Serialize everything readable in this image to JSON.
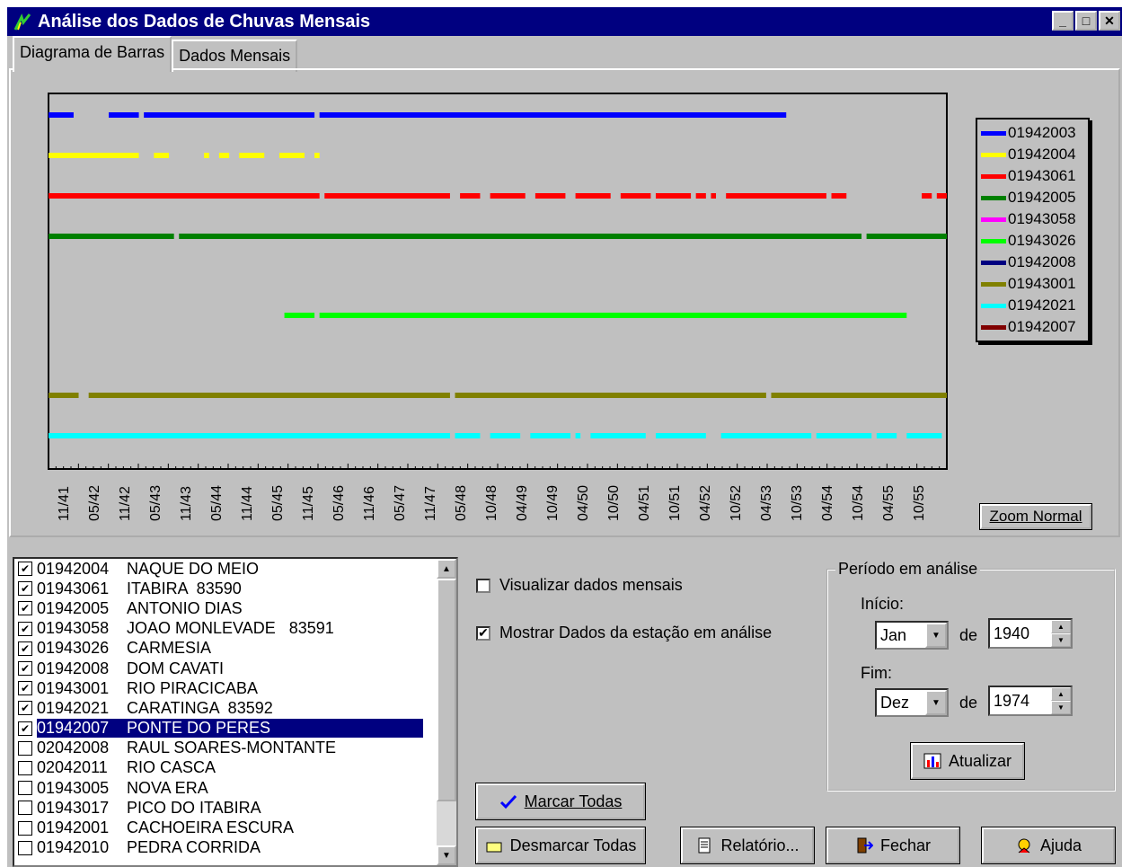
{
  "window": {
    "title": "Análise dos Dados de Chuvas Mensais",
    "min_label": "_",
    "max_label": "□",
    "close_label": "✕"
  },
  "tabs": [
    {
      "label": "Diagrama de Barras",
      "active": true
    },
    {
      "label": "Dados Mensais",
      "active": false
    }
  ],
  "chart": {
    "x_ticks": [
      "11/41",
      "05/42",
      "11/42",
      "05/43",
      "11/43",
      "05/44",
      "11/44",
      "05/45",
      "11/45",
      "05/46",
      "11/46",
      "05/47",
      "11/47",
      "05/48",
      "10/48",
      "04/49",
      "10/49",
      "04/50",
      "10/50",
      "04/51",
      "10/51",
      "04/52",
      "10/52",
      "04/53",
      "10/53",
      "04/54",
      "10/54",
      "04/55",
      "10/55"
    ],
    "zoom_button": "Zoom Normal"
  },
  "chart_data": {
    "type": "bar",
    "title": "",
    "xlabel": "",
    "ylabel": "",
    "x_range": [
      "1941-07",
      "1956-06"
    ],
    "legend_position": "right",
    "series": [
      {
        "name": "01942003",
        "color": "#0000ff",
        "segments": [
          [
            "1941-07",
            "1941-12"
          ],
          [
            "1942-07",
            "1943-01"
          ],
          [
            "1943-02",
            "1945-12"
          ],
          [
            "1946-01",
            "1953-10"
          ]
        ]
      },
      {
        "name": "01942004",
        "color": "#ffff00",
        "segments": [
          [
            "1941-07",
            "1943-01"
          ],
          [
            "1943-04",
            "1943-07"
          ],
          [
            "1944-02",
            "1944-03"
          ],
          [
            "1944-05",
            "1944-07"
          ],
          [
            "1944-09",
            "1945-02"
          ],
          [
            "1945-05",
            "1945-10"
          ],
          [
            "1945-12",
            "1946-01"
          ]
        ]
      },
      {
        "name": "01943061",
        "color": "#ff0000",
        "segments": [
          [
            "1941-07",
            "1946-01"
          ],
          [
            "1946-02",
            "1948-03"
          ],
          [
            "1948-05",
            "1948-09"
          ],
          [
            "1948-11",
            "1949-06"
          ],
          [
            "1949-08",
            "1950-02"
          ],
          [
            "1950-04",
            "1950-11"
          ],
          [
            "1951-01",
            "1951-07"
          ],
          [
            "1951-08",
            "1952-03"
          ],
          [
            "1952-04",
            "1952-06"
          ],
          [
            "1952-07",
            "1952-08"
          ],
          [
            "1952-10",
            "1954-06"
          ],
          [
            "1954-07",
            "1954-10"
          ],
          [
            "1956-01",
            "1956-03"
          ],
          [
            "1956-04",
            "1956-06"
          ]
        ]
      },
      {
        "name": "01942005",
        "color": "#008000",
        "segments": [
          [
            "1941-07",
            "1943-08"
          ],
          [
            "1943-09",
            "1955-01"
          ],
          [
            "1955-02",
            "1956-06"
          ]
        ]
      },
      {
        "name": "01943058",
        "color": "#ff00ff",
        "segments": []
      },
      {
        "name": "01943026",
        "color": "#00ff00",
        "segments": [
          [
            "1945-06",
            "1945-12"
          ],
          [
            "1946-01",
            "1955-10"
          ]
        ]
      },
      {
        "name": "01942008",
        "color": "#000080",
        "segments": []
      },
      {
        "name": "01943001",
        "color": "#808000",
        "segments": [
          [
            "1941-07",
            "1942-01"
          ],
          [
            "1942-03",
            "1948-03"
          ],
          [
            "1948-04",
            "1953-06"
          ],
          [
            "1953-07",
            "1956-06"
          ]
        ]
      },
      {
        "name": "01942021",
        "color": "#00ffff",
        "segments": [
          [
            "1941-07",
            "1948-03"
          ],
          [
            "1948-04",
            "1948-09"
          ],
          [
            "1948-11",
            "1949-05"
          ],
          [
            "1949-07",
            "1950-03"
          ],
          [
            "1950-04",
            "1950-05"
          ],
          [
            "1950-07",
            "1951-06"
          ],
          [
            "1951-08",
            "1952-06"
          ],
          [
            "1952-09",
            "1954-03"
          ],
          [
            "1954-04",
            "1955-03"
          ],
          [
            "1955-04",
            "1955-08"
          ],
          [
            "1955-10",
            "1956-05"
          ]
        ]
      },
      {
        "name": "01942007",
        "color": "#800000",
        "segments": []
      }
    ]
  },
  "stations": [
    {
      "checked": true,
      "code": "01942004",
      "name": "NAQUE DO MEIO",
      "selected": false
    },
    {
      "checked": true,
      "code": "01943061",
      "name": "ITABIRA  83590",
      "selected": false
    },
    {
      "checked": true,
      "code": "01942005",
      "name": "ANTONIO DIAS",
      "selected": false
    },
    {
      "checked": true,
      "code": "01943058",
      "name": "JOAO MONLEVADE   83591",
      "selected": false
    },
    {
      "checked": true,
      "code": "01943026",
      "name": "CARMESIA",
      "selected": false
    },
    {
      "checked": true,
      "code": "01942008",
      "name": "DOM CAVATI",
      "selected": false
    },
    {
      "checked": true,
      "code": "01943001",
      "name": "RIO PIRACICABA",
      "selected": false
    },
    {
      "checked": true,
      "code": "01942021",
      "name": "CARATINGA  83592",
      "selected": false
    },
    {
      "checked": true,
      "code": "01942007",
      "name": "PONTE DO PERES",
      "selected": true
    },
    {
      "checked": false,
      "code": "02042008",
      "name": "RAUL SOARES-MONTANTE",
      "selected": false
    },
    {
      "checked": false,
      "code": "02042011",
      "name": "RIO CASCA",
      "selected": false
    },
    {
      "checked": false,
      "code": "01943005",
      "name": "NOVA ERA",
      "selected": false
    },
    {
      "checked": false,
      "code": "01943017",
      "name": "PICO DO ITABIRA",
      "selected": false
    },
    {
      "checked": false,
      "code": "01942001",
      "name": "CACHOEIRA ESCURA",
      "selected": false
    },
    {
      "checked": false,
      "code": "01942010",
      "name": "PEDRA CORRIDA",
      "selected": false
    }
  ],
  "options": {
    "visualizar_label": "Visualizar dados mensais",
    "visualizar_checked": false,
    "mostrar_label": "Mostrar Dados da estação em análise",
    "mostrar_checked": true
  },
  "buttons": {
    "marcar": "Marcar Todas",
    "desmarcar": "Desmarcar Todas",
    "relatorio": "Relatório...",
    "fechar": "Fechar",
    "ajuda": "Ajuda",
    "atualizar": "Atualizar"
  },
  "periodo": {
    "title": "Período em análise",
    "inicio_label": "Início:",
    "inicio_month": "Jan",
    "inicio_year": "1940",
    "fim_label": "Fim:",
    "fim_month": "Dez",
    "fim_year": "1974",
    "de_label": "de"
  }
}
